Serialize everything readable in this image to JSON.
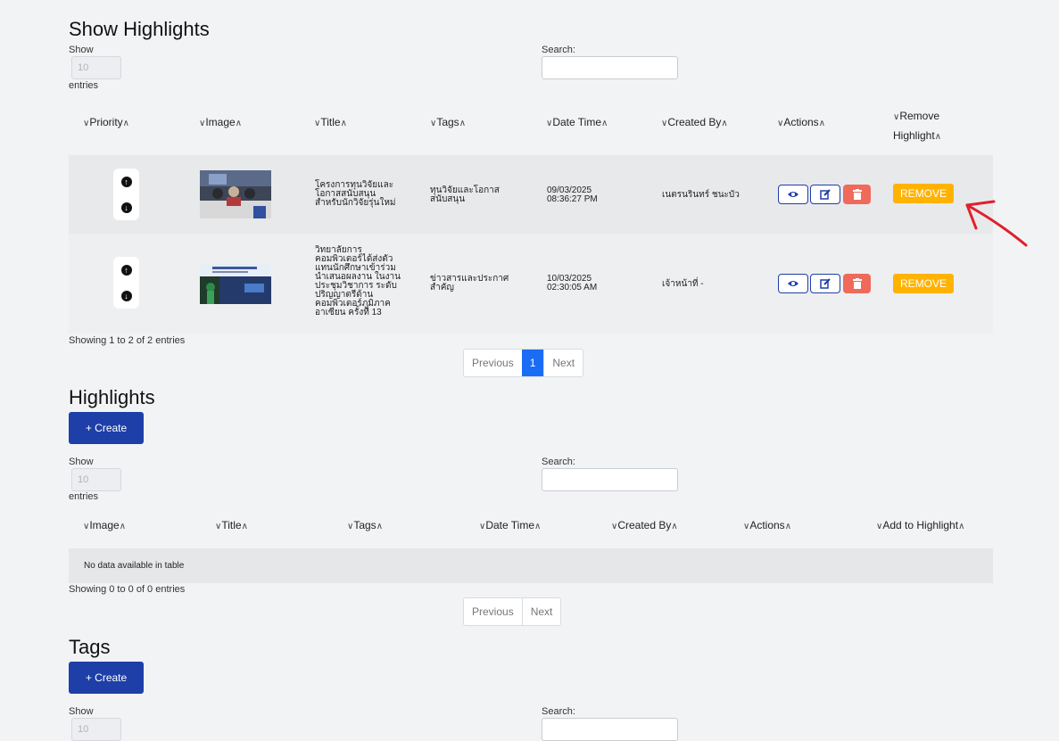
{
  "show_highlights": {
    "title": "Show Highlights",
    "show_label": "Show",
    "entries_label": "entries",
    "entries_value": "10",
    "search_label": "Search:",
    "columns": [
      "Priority",
      "Image",
      "Title",
      "Tags",
      "Date Time",
      "Created By",
      "Actions",
      "Remove",
      "Highlight"
    ],
    "rows": [
      {
        "title_lines": [
          "โครงการทุนวิจัยและ",
          "โอกาสสนับสนุน",
          "สำหรับนักวิจัยรุ่นใหม่"
        ],
        "tag_lines": [
          "ทุนวิจัยและโอกาส",
          "สนับสนุน"
        ],
        "date": "09/03/2025",
        "time": "08:36:27 PM",
        "created_by": "เนตรนรินทร์ ชนะบัว",
        "remove_label": "REMOVE"
      },
      {
        "title_lines": [
          "วิทยาลัยการ",
          "คอมพิวเตอร์ได้ส่งตัว",
          "แทนนักศึกษาเข้าร่วม",
          "นำเสนอผลงาน ในงาน",
          "ประชุมวิชาการ ระดับ",
          "ปริญญาตรีด้าน",
          "คอมพิวเตอร์ภูมิภาค",
          "อาเซียน ครั้งที่ 13"
        ],
        "tag_lines": [
          "ข่าวสารและประกาศ",
          "สำคัญ"
        ],
        "date": "10/03/2025",
        "time": "02:30:05 AM",
        "created_by": "เจ้าหน้าที่ -",
        "remove_label": "REMOVE"
      }
    ],
    "info": "Showing 1 to 2 of 2 entries",
    "pager": {
      "previous": "Previous",
      "page": "1",
      "next": "Next"
    }
  },
  "highlights": {
    "title": "Highlights",
    "create_label": "+ Create",
    "show_label": "Show",
    "entries_label": "entries",
    "entries_value": "10",
    "search_label": "Search:",
    "columns": [
      "Image",
      "Title",
      "Tags",
      "Date Time",
      "Created By",
      "Actions",
      "Add to Highlight"
    ],
    "empty": "No data available in table",
    "info": "Showing 0 to 0 of 0 entries",
    "pager": {
      "previous": "Previous",
      "next": "Next"
    }
  },
  "tags": {
    "title": "Tags",
    "create_label": "+ Create",
    "show_label": "Show",
    "entries_value": "10",
    "search_label": "Search:"
  },
  "colors": {
    "primary": "#1e3fa8",
    "danger": "#ef6a5a",
    "warning": "#ffb300",
    "page_active": "#1a6cf5",
    "annotation": "#e0202a"
  },
  "icons": [
    "arrow-up-icon",
    "arrow-down-icon",
    "eye-icon",
    "edit-icon",
    "trash-icon",
    "sort-icon"
  ]
}
